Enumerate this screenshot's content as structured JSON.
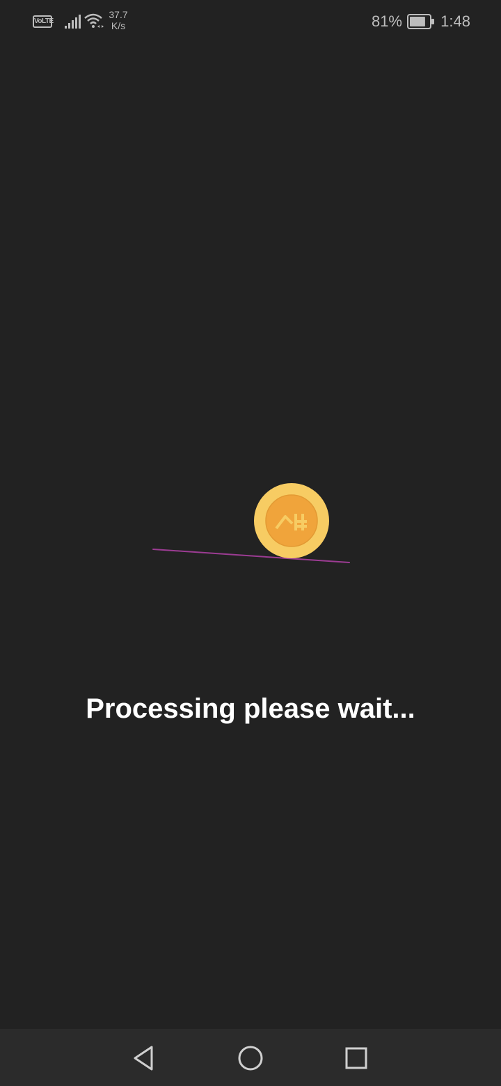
{
  "status_bar": {
    "volte": "VoLTE",
    "speed_value": "37.7",
    "speed_unit": "K/s",
    "battery": "81%",
    "time": "1:48",
    "battery_level": 0.81
  },
  "main": {
    "message": "Processing please wait..."
  },
  "icons": {
    "signal": "signal-bars-icon",
    "wifi": "wifi-icon",
    "battery": "battery-icon",
    "coin": "coin-logo-icon",
    "back": "back-triangle-icon",
    "home": "home-circle-icon",
    "recent": "recent-square-icon"
  },
  "colors": {
    "background": "#222222",
    "coin_outer": "#f7cc63",
    "coin_inner": "#f0a43b",
    "track": "#9c3c93"
  }
}
